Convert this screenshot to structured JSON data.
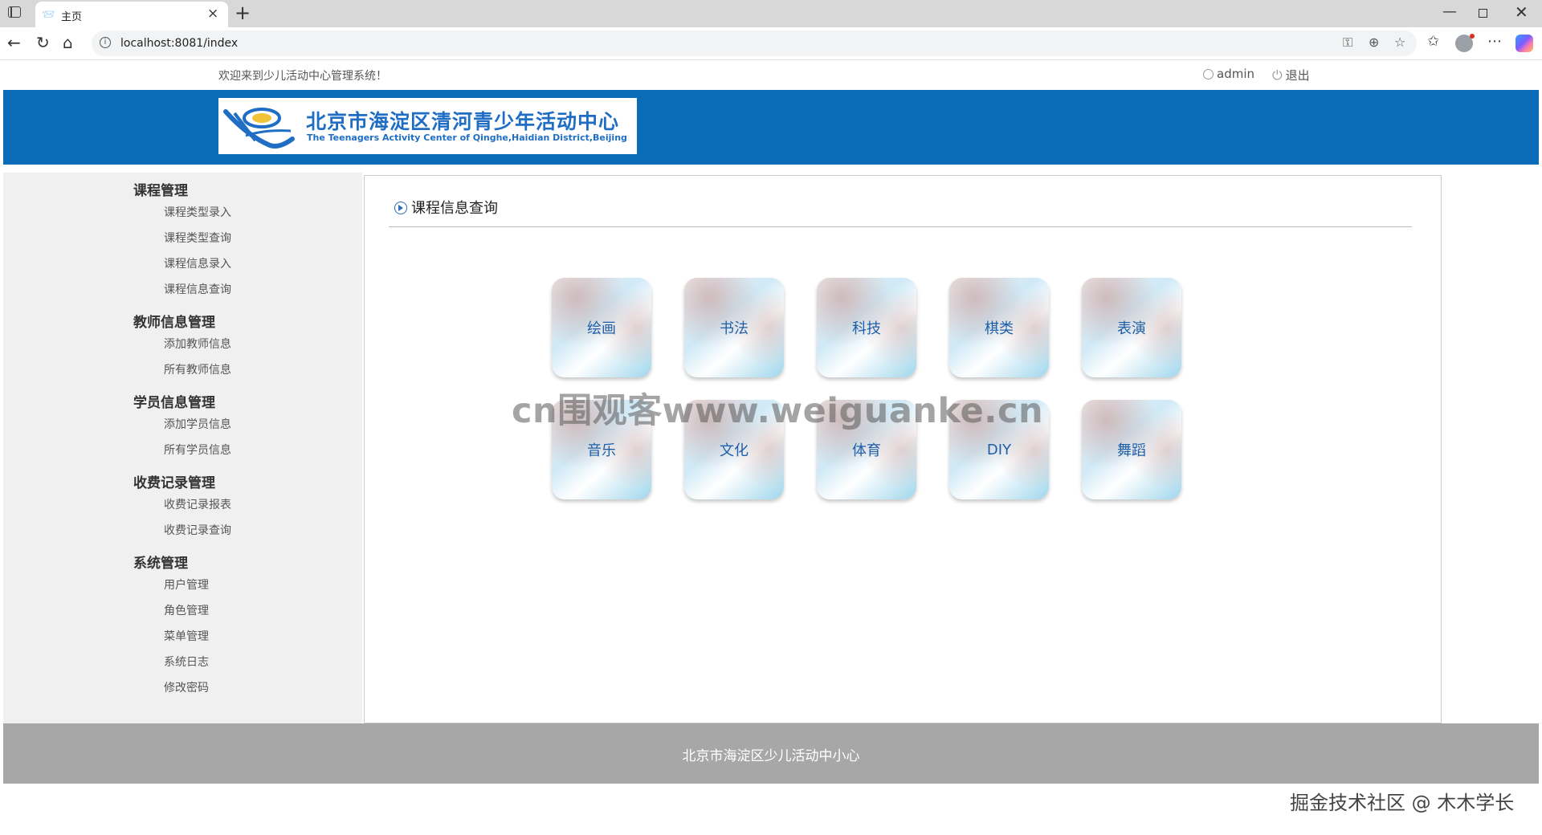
{
  "browser": {
    "tab_title": "主页",
    "url": "localhost:8081/index"
  },
  "topbar": {
    "welcome": "欢迎来到少儿活动中心管理系统！",
    "username": "admin",
    "logout": "退出"
  },
  "banner": {
    "title_cn": "北京市海淀区清河青少年活动中心",
    "title_en": "The Teenagers Activity Center of Qinghe,Haidian District,Beijing"
  },
  "sidebar": {
    "groups": [
      {
        "title": "课程管理",
        "items": [
          "课程类型录入",
          "课程类型查询",
          "课程信息录入",
          "课程信息查询"
        ]
      },
      {
        "title": "教师信息管理",
        "items": [
          "添加教师信息",
          "所有教师信息"
        ]
      },
      {
        "title": "学员信息管理",
        "items": [
          "添加学员信息",
          "所有学员信息"
        ]
      },
      {
        "title": "收费记录管理",
        "items": [
          "收费记录报表",
          "收费记录查询"
        ]
      },
      {
        "title": "系统管理",
        "items": [
          "用户管理",
          "角色管理",
          "菜单管理",
          "系统日志",
          "修改密码"
        ]
      }
    ]
  },
  "content": {
    "title": "课程信息查询",
    "categories": [
      "绘画",
      "书法",
      "科技",
      "棋类",
      "表演",
      "音乐",
      "文化",
      "体育",
      "DIY",
      "舞蹈"
    ]
  },
  "footer": {
    "text": "北京市海淀区少儿活动中小心"
  },
  "watermark": "cn围观客www.weiguanke.cn",
  "credit": "掘金技术社区 @ 木木学长"
}
